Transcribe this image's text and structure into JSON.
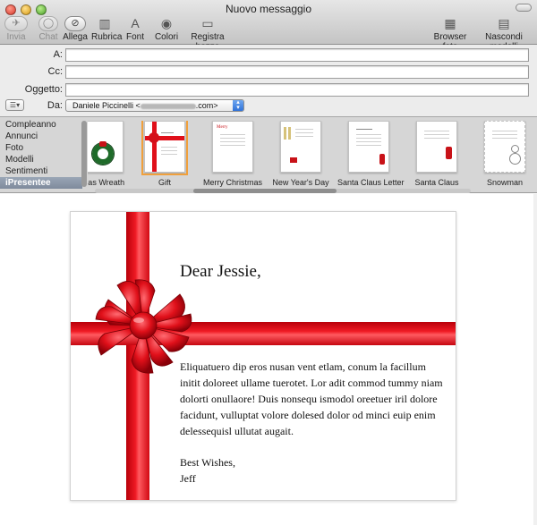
{
  "window": {
    "title": "Nuovo messaggio"
  },
  "toolbar": {
    "send": "Invia",
    "chat": "Chat",
    "attach": "Allega",
    "address": "Rubrica",
    "font": "Font",
    "colors": "Colori",
    "save_draft": "Registra bozza",
    "photo_browser": "Browser foto",
    "hide_stationery": "Nascondi modelli"
  },
  "fields": {
    "to_label": "A:",
    "cc_label": "Cc:",
    "subject_label": "Oggetto:",
    "from_label": "Da:",
    "from_name": "Daniele Piccinelli <",
    "from_suffix": ".com>"
  },
  "categories": [
    {
      "label": "Compleanno"
    },
    {
      "label": "Annunci"
    },
    {
      "label": "Foto"
    },
    {
      "label": "Modelli"
    },
    {
      "label": "Sentimenti"
    },
    {
      "label": "iPresentee",
      "selected": true
    }
  ],
  "stationery": [
    {
      "name": "mas Wreath"
    },
    {
      "name": "Gift",
      "selected": true
    },
    {
      "name": "Merry Christmas"
    },
    {
      "name": "New Year's Day"
    },
    {
      "name": "Santa Claus Letter"
    },
    {
      "name": "Santa Claus"
    },
    {
      "name": "Snowman"
    }
  ],
  "message": {
    "greeting": "Dear Jessie,",
    "body": "Eliquatuero dip eros nusan vent etlam, conum la facillum initit doloreet ullame tuerotet. Lor adit commod tummy niam dolorti onullaore! Duis nonsequ ismodol oreetuer iril dolore facidunt, vulluptat volore dolesed dolor od minci euip enim delessequisl ullutat augait.",
    "closing": "Best Wishes,",
    "signature": "Jeff"
  },
  "colors": {
    "ribbon": "#e0101a",
    "selection": "#f0a03c"
  }
}
